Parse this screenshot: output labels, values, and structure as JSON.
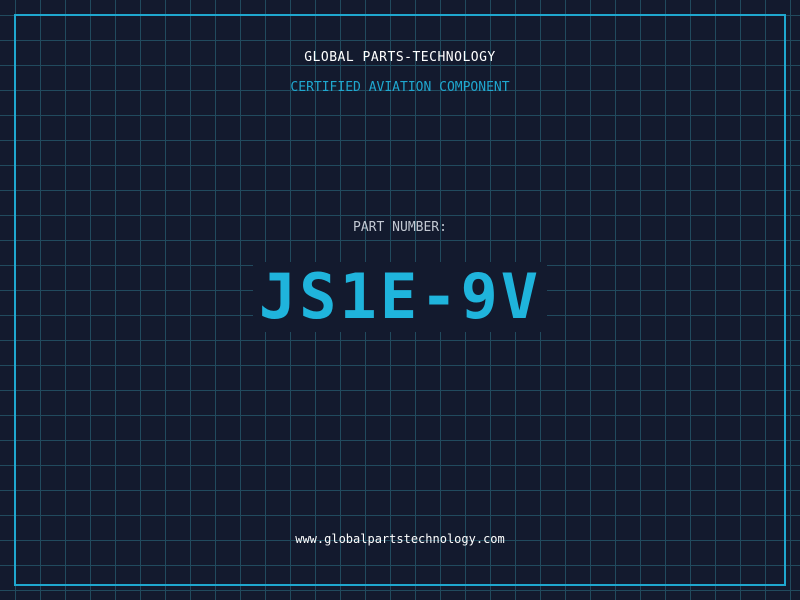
{
  "header": {
    "company": "GLOBAL PARTS-TECHNOLOGY",
    "subtitle": "CERTIFIED AVIATION COMPONENT"
  },
  "part": {
    "label": "PART NUMBER:",
    "number": "JS1E-9V"
  },
  "footer": {
    "website": "www.globalpartstechnology.com"
  },
  "colors": {
    "background": "#131a2e",
    "grid": "#214a5e",
    "accent": "#1fa7cf",
    "text": "#ffffff"
  }
}
